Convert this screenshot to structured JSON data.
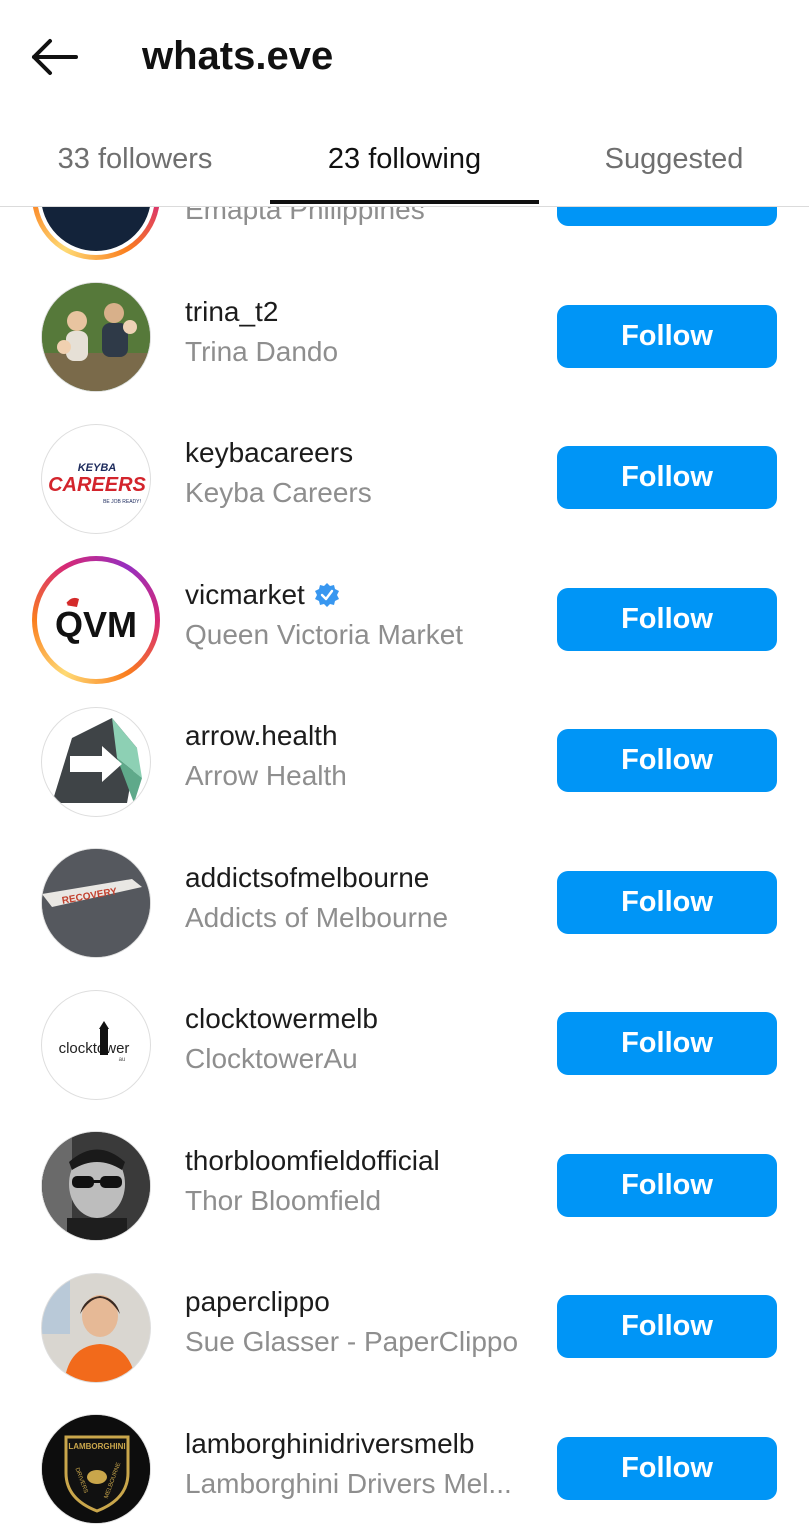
{
  "header": {
    "title": "whats.eve",
    "back_icon": "arrow-left-icon"
  },
  "tabs": [
    {
      "label": "33 followers",
      "active": false
    },
    {
      "label": "23 following",
      "active": true
    },
    {
      "label": "Suggested",
      "active": false
    }
  ],
  "colors": {
    "accent": "#0095f6",
    "text_primary": "#262626",
    "text_secondary": "#8e8e8e",
    "verified": "#3897f0"
  },
  "rows": [
    {
      "username": "",
      "fullname": "Emapta Philippines",
      "button": "",
      "story": true,
      "verified": false
    },
    {
      "username": "trina_t2",
      "fullname": "Trina Dando",
      "button": "Follow",
      "story": false,
      "verified": false
    },
    {
      "username": "keybacareers",
      "fullname": "Keyba Careers",
      "button": "Follow",
      "story": false,
      "verified": false,
      "avatar_text": "KEYBA CAREERS",
      "avatar_subtext": "BE JOB READY!"
    },
    {
      "username": "vicmarket",
      "fullname": "Queen Victoria Market",
      "button": "Follow",
      "story": true,
      "verified": true,
      "avatar_text": "QVM"
    },
    {
      "username": "arrow.health",
      "fullname": "Arrow Health",
      "button": "Follow",
      "story": false,
      "verified": false
    },
    {
      "username": "addictsofmelbourne",
      "fullname": "Addicts of Melbourne",
      "button": "Follow",
      "story": false,
      "verified": false,
      "avatar_text": "RECOVERY"
    },
    {
      "username": "clocktowermelb",
      "fullname": "ClocktowerAu",
      "button": "Follow",
      "story": false,
      "verified": false,
      "avatar_text": "clocktower",
      "avatar_subtext": "au"
    },
    {
      "username": "thorbloomfieldofficial",
      "fullname": "Thor Bloomfield",
      "button": "Follow",
      "story": false,
      "verified": false
    },
    {
      "username": "paperclippo",
      "fullname": "Sue Glasser - PaperClippo",
      "button": "Follow",
      "story": false,
      "verified": false
    },
    {
      "username": "lamborghinidriversmelb",
      "fullname": "Lamborghini Drivers Mel...",
      "button": "Follow",
      "story": false,
      "verified": false,
      "avatar_text": "LAMBORGHINI",
      "avatar_subtext": "DRIVERS MELBOURNE"
    }
  ]
}
